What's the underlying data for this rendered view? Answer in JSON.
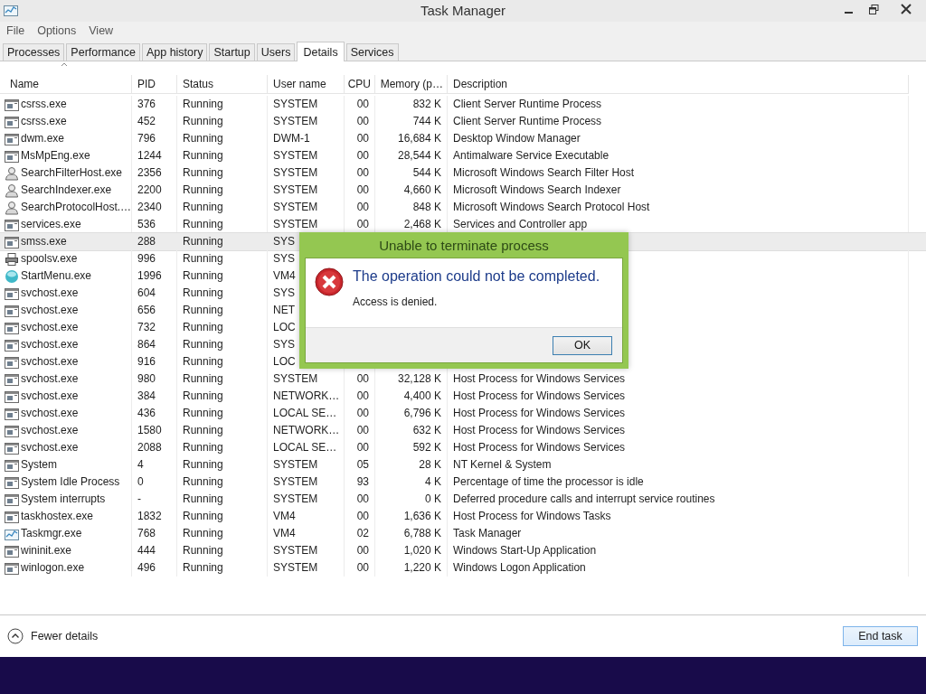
{
  "window": {
    "title": "Task Manager"
  },
  "menu": [
    "File",
    "Options",
    "View"
  ],
  "tabs": [
    {
      "label": "Processes",
      "selected": false
    },
    {
      "label": "Performance",
      "selected": false
    },
    {
      "label": "App history",
      "selected": false
    },
    {
      "label": "Startup",
      "selected": false
    },
    {
      "label": "Users",
      "selected": false
    },
    {
      "label": "Details",
      "selected": true
    },
    {
      "label": "Services",
      "selected": false
    }
  ],
  "table": {
    "columns": [
      "Name",
      "PID",
      "Status",
      "User name",
      "CPU",
      "Memory (p…",
      "Description"
    ],
    "rows": [
      {
        "kind": "window",
        "name": "csrss.exe",
        "pid": "376",
        "status": "Running",
        "user": "SYSTEM",
        "cpu": "00",
        "memory": "832 K",
        "description": "Client Server Runtime Process",
        "selected": false
      },
      {
        "kind": "window",
        "name": "csrss.exe",
        "pid": "452",
        "status": "Running",
        "user": "SYSTEM",
        "cpu": "00",
        "memory": "744 K",
        "description": "Client Server Runtime Process",
        "selected": false
      },
      {
        "kind": "window",
        "name": "dwm.exe",
        "pid": "796",
        "status": "Running",
        "user": "DWM-1",
        "cpu": "00",
        "memory": "16,684 K",
        "description": "Desktop Window Manager",
        "selected": false
      },
      {
        "kind": "window",
        "name": "MsMpEng.exe",
        "pid": "1244",
        "status": "Running",
        "user": "SYSTEM",
        "cpu": "00",
        "memory": "28,544 K",
        "description": "Antimalware Service Executable",
        "selected": false
      },
      {
        "kind": "user",
        "name": "SearchFilterHost.exe",
        "pid": "2356",
        "status": "Running",
        "user": "SYSTEM",
        "cpu": "00",
        "memory": "544 K",
        "description": "Microsoft Windows Search Filter Host",
        "selected": false
      },
      {
        "kind": "user",
        "name": "SearchIndexer.exe",
        "pid": "2200",
        "status": "Running",
        "user": "SYSTEM",
        "cpu": "00",
        "memory": "4,660 K",
        "description": "Microsoft Windows Search Indexer",
        "selected": false
      },
      {
        "kind": "user",
        "name": "SearchProtocolHost.…",
        "pid": "2340",
        "status": "Running",
        "user": "SYSTEM",
        "cpu": "00",
        "memory": "848 K",
        "description": "Microsoft Windows Search Protocol Host",
        "selected": false
      },
      {
        "kind": "window",
        "name": "services.exe",
        "pid": "536",
        "status": "Running",
        "user": "SYSTEM",
        "cpu": "00",
        "memory": "2,468 K",
        "description": "Services and Controller app",
        "selected": false
      },
      {
        "kind": "window",
        "name": "smss.exe",
        "pid": "288",
        "status": "Running",
        "user": "SYS",
        "selected": true
      },
      {
        "kind": "printer",
        "name": "spoolsv.exe",
        "pid": "996",
        "status": "Running",
        "user": "SYS",
        "selected": false
      },
      {
        "kind": "orb",
        "name": "StartMenu.exe",
        "pid": "1996",
        "status": "Running",
        "user": "VM4",
        "selected": false
      },
      {
        "kind": "window",
        "name": "svchost.exe",
        "pid": "604",
        "status": "Running",
        "user": "SYS",
        "selected": false
      },
      {
        "kind": "window",
        "name": "svchost.exe",
        "pid": "656",
        "status": "Running",
        "user": "NET",
        "selected": false
      },
      {
        "kind": "window",
        "name": "svchost.exe",
        "pid": "732",
        "status": "Running",
        "user": "LOC",
        "selected": false
      },
      {
        "kind": "window",
        "name": "svchost.exe",
        "pid": "864",
        "status": "Running",
        "user": "SYS",
        "selected": false
      },
      {
        "kind": "window",
        "name": "svchost.exe",
        "pid": "916",
        "status": "Running",
        "user": "LOC",
        "selected": false
      },
      {
        "kind": "window",
        "name": "svchost.exe",
        "pid": "980",
        "status": "Running",
        "user": "SYSTEM",
        "cpu": "00",
        "memory": "32,128 K",
        "description": "Host Process for Windows Services",
        "selected": false
      },
      {
        "kind": "window",
        "name": "svchost.exe",
        "pid": "384",
        "status": "Running",
        "user": "NETWORK…",
        "cpu": "00",
        "memory": "4,400 K",
        "description": "Host Process for Windows Services",
        "selected": false
      },
      {
        "kind": "window",
        "name": "svchost.exe",
        "pid": "436",
        "status": "Running",
        "user": "LOCAL SE…",
        "cpu": "00",
        "memory": "6,796 K",
        "description": "Host Process for Windows Services",
        "selected": false
      },
      {
        "kind": "window",
        "name": "svchost.exe",
        "pid": "1580",
        "status": "Running",
        "user": "NETWORK…",
        "cpu": "00",
        "memory": "632 K",
        "description": "Host Process for Windows Services",
        "selected": false
      },
      {
        "kind": "window",
        "name": "svchost.exe",
        "pid": "2088",
        "status": "Running",
        "user": "LOCAL SE…",
        "cpu": "00",
        "memory": "592 K",
        "description": "Host Process for Windows Services",
        "selected": false
      },
      {
        "kind": "window",
        "name": "System",
        "pid": "4",
        "status": "Running",
        "user": "SYSTEM",
        "cpu": "05",
        "memory": "28 K",
        "description": "NT Kernel & System",
        "selected": false
      },
      {
        "kind": "window",
        "name": "System Idle Process",
        "pid": "0",
        "status": "Running",
        "user": "SYSTEM",
        "cpu": "93",
        "memory": "4 K",
        "description": "Percentage of time the processor is idle",
        "selected": false
      },
      {
        "kind": "window",
        "name": "System interrupts",
        "pid": "-",
        "status": "Running",
        "user": "SYSTEM",
        "cpu": "00",
        "memory": "0 K",
        "description": "Deferred procedure calls and interrupt service routines",
        "selected": false
      },
      {
        "kind": "window",
        "name": "taskhostex.exe",
        "pid": "1832",
        "status": "Running",
        "user": "VM4",
        "cpu": "00",
        "memory": "1,636 K",
        "description": "Host Process for Windows Tasks",
        "selected": false
      },
      {
        "kind": "chart",
        "name": "Taskmgr.exe",
        "pid": "768",
        "status": "Running",
        "user": "VM4",
        "cpu": "02",
        "memory": "6,788 K",
        "description": "Task Manager",
        "selected": false
      },
      {
        "kind": "window",
        "name": "wininit.exe",
        "pid": "444",
        "status": "Running",
        "user": "SYSTEM",
        "cpu": "00",
        "memory": "1,020 K",
        "description": "Windows Start-Up Application",
        "selected": false
      },
      {
        "kind": "window",
        "name": "winlogon.exe",
        "pid": "496",
        "status": "Running",
        "user": "SYSTEM",
        "cpu": "00",
        "memory": "1,220 K",
        "description": "Windows Logon Application",
        "selected": false
      }
    ]
  },
  "dialog": {
    "title": "Unable to terminate process",
    "heading": "The operation could not be completed.",
    "message": "Access is denied.",
    "button": "OK"
  },
  "footer": {
    "toggle": "Fewer details",
    "button": "End task"
  }
}
